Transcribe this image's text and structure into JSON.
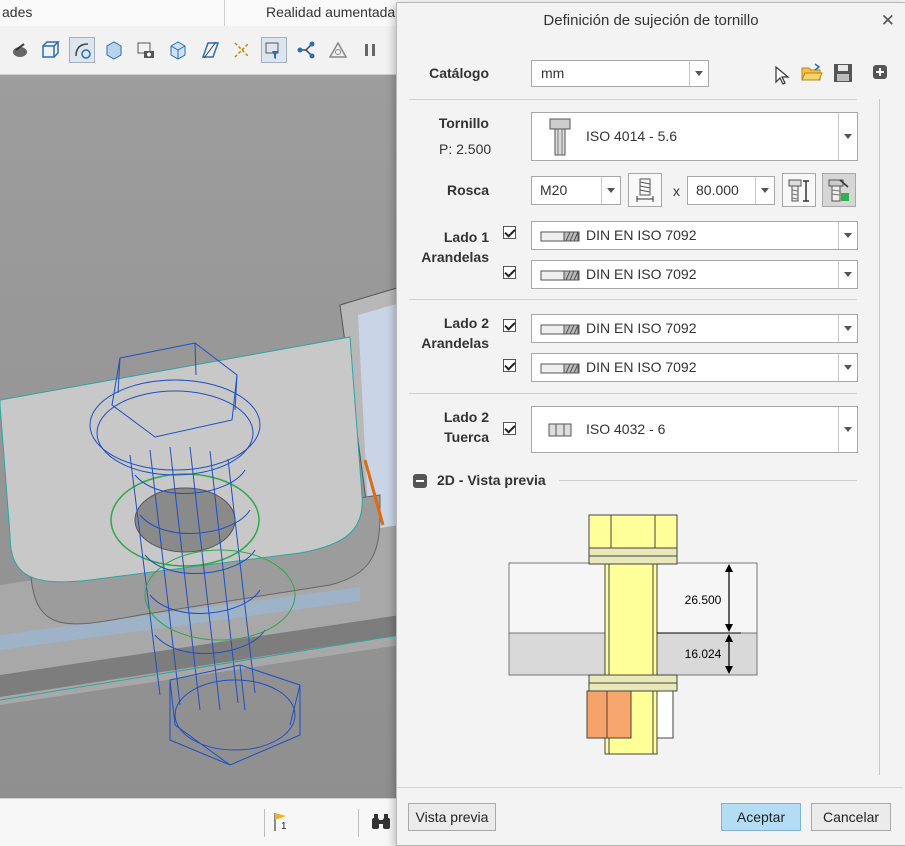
{
  "app": {
    "tabs": [
      "ades",
      "Realidad aumentada"
    ],
    "statusbar": {
      "flag_count": "1"
    }
  },
  "dialog": {
    "title": "Definición de sujeción de tornillo",
    "catalog": {
      "label": "Catálogo",
      "value": "mm"
    },
    "screw": {
      "label": "Tornillo",
      "pitch": "P: 2.500",
      "value": "ISO 4014 - 5.6"
    },
    "thread": {
      "label": "Rosca",
      "size": "M20",
      "times": "x",
      "length": "80.000"
    },
    "side1_washers": {
      "label1": "Lado 1",
      "label2": "Arandelas",
      "items": [
        "DIN EN ISO 7092",
        "DIN EN ISO 7092"
      ]
    },
    "side2_washers": {
      "label1": "Lado 2",
      "label2": "Arandelas",
      "items": [
        "DIN EN ISO 7092",
        "DIN EN ISO 7092"
      ]
    },
    "side2_nut": {
      "label1": "Lado 2",
      "label2": "Tuerca",
      "value": "ISO 4032 - 6"
    },
    "preview": {
      "section_label": "2D - Vista previa",
      "dim_top": "26.500",
      "dim_bottom": "16.024"
    },
    "buttons": {
      "preview": "Vista previa",
      "ok": "Aceptar",
      "cancel": "Cancelar"
    }
  },
  "colors": {
    "accent_button": "#b4dcf5",
    "screw_fill": "#ffff99",
    "nut_fill": "#f5a36b"
  }
}
